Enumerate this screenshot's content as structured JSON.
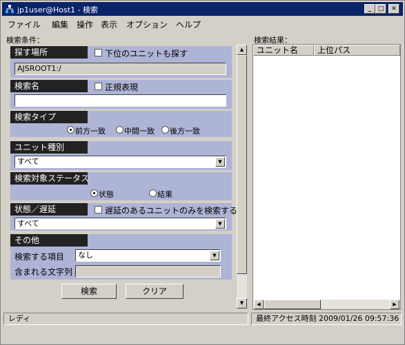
{
  "window": {
    "title": "jp1user@Host1  - 検索",
    "minimize_glyph": "_",
    "maximize_glyph": "□",
    "close_glyph": "✕"
  },
  "menu": [
    "ファイル",
    "編集",
    "操作",
    "表示",
    "オプション",
    "ヘルプ"
  ],
  "search_conditions": {
    "header": "検索条件：",
    "location": {
      "title": "探す場所",
      "include_upper_label": "下位のユニットも探す",
      "include_upper_checked": false,
      "path_value": "AJSROOT1:/"
    },
    "name": {
      "title": "検索名",
      "regex_label": "正規表現",
      "regex_checked": false,
      "value": ""
    },
    "search_type": {
      "title": "検索タイプ",
      "options": [
        "前方一致",
        "中間一致",
        "後方一致"
      ],
      "selected": "前方一致"
    },
    "unit_type": {
      "title": "ユニット種別",
      "value": "すべて"
    },
    "target_status": {
      "title": "検索対象ステータス",
      "options": [
        "状態",
        "結果"
      ],
      "selected": "状態"
    },
    "status_delay": {
      "title": "状態／遅延",
      "delayed_only_label": "遅延のあるユニットのみを検索する",
      "delayed_only_checked": false,
      "value": "すべて"
    },
    "other": {
      "title": "その他",
      "search_item_label": "検索する項目",
      "search_item_value": "なし",
      "contains_label": "含まれる文字列",
      "contains_value": ""
    },
    "search_button": "検索",
    "clear_button": "クリア"
  },
  "search_results": {
    "header": "検索結果：",
    "columns": [
      "ユニット名",
      "上位パス"
    ],
    "rows": []
  },
  "statusbar": {
    "left": "レディ",
    "right": "最終アクセス時刻 2009/01/26 09:57:36"
  },
  "icons": {
    "scroll_up": "▲",
    "scroll_down": "▼",
    "scroll_left": "◀",
    "scroll_right": "▶",
    "dropdown": "▼"
  }
}
